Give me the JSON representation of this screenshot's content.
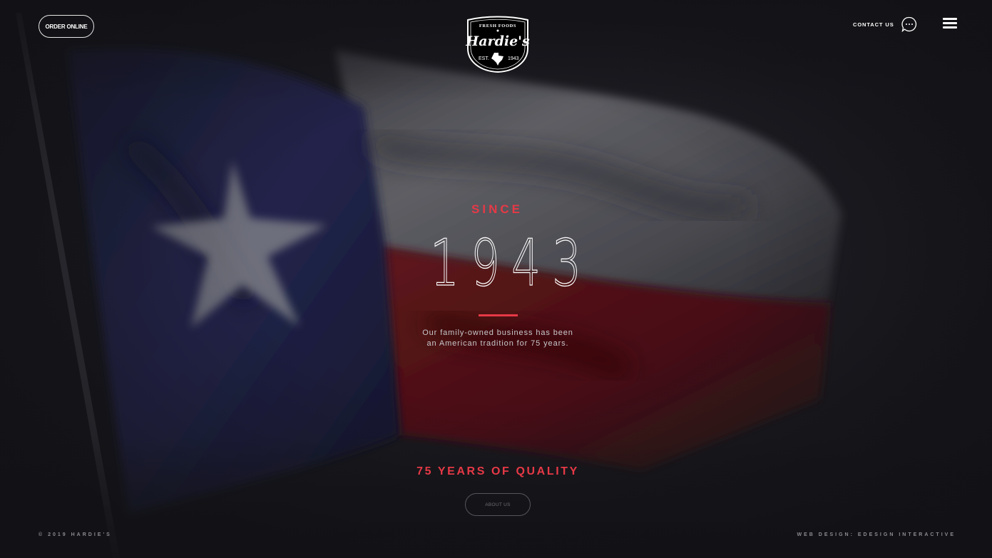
{
  "header": {
    "order_button_label": "ORDER ONLINE",
    "logo": {
      "top_text": "FRESH FOODS",
      "brand": "Hardie's",
      "est_label": "EST.",
      "est_year": "1943"
    },
    "contact_label": "CONTACT US"
  },
  "hero": {
    "since_label": "SINCE",
    "year": "1943",
    "description_line1": "Our family-owned business has been",
    "description_line2": "an American tradition for 75 years."
  },
  "quality": {
    "heading": "75 YEARS OF QUALITY",
    "about_button_label": "ABOUT US"
  },
  "footer": {
    "copyright": "© 2019 HARDIE'S",
    "credit": "WEB DESIGN: EDESIGN INTERACTIVE"
  },
  "icons": {
    "chat": "chat-bubble-icon",
    "menu": "hamburger-menu-icon",
    "texas": "texas-state-icon"
  },
  "colors": {
    "accent_red": "#e63946",
    "background": "#16161b",
    "flag_blue": "#1f2148",
    "flag_red": "#5a1218",
    "flag_white": "#6a6a70"
  }
}
